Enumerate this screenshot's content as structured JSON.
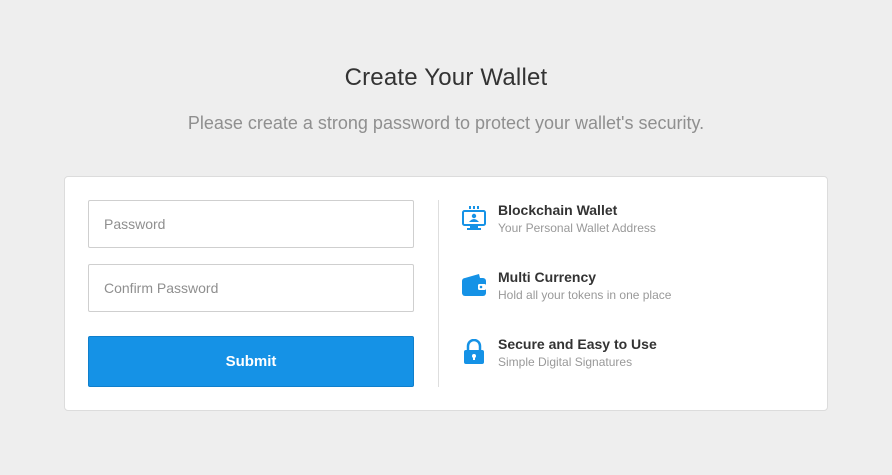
{
  "header": {
    "title": "Create Your Wallet",
    "subtitle": "Please create a strong password to protect your wallet's security."
  },
  "form": {
    "password_placeholder": "Password",
    "password_value": "",
    "confirm_placeholder": "Confirm Password",
    "confirm_value": "",
    "submit_label": "Submit"
  },
  "features": [
    {
      "icon": "monitor-network-icon",
      "title": "Blockchain Wallet",
      "description": "Your Personal Wallet Address"
    },
    {
      "icon": "wallet-icon",
      "title": "Multi Currency",
      "description": "Hold all your tokens in one place"
    },
    {
      "icon": "lock-icon",
      "title": "Secure and Easy to Use",
      "description": "Simple Digital Signatures"
    }
  ],
  "colors": {
    "accent": "#1592e6",
    "background": "#eeeeee",
    "card": "#ffffff"
  }
}
